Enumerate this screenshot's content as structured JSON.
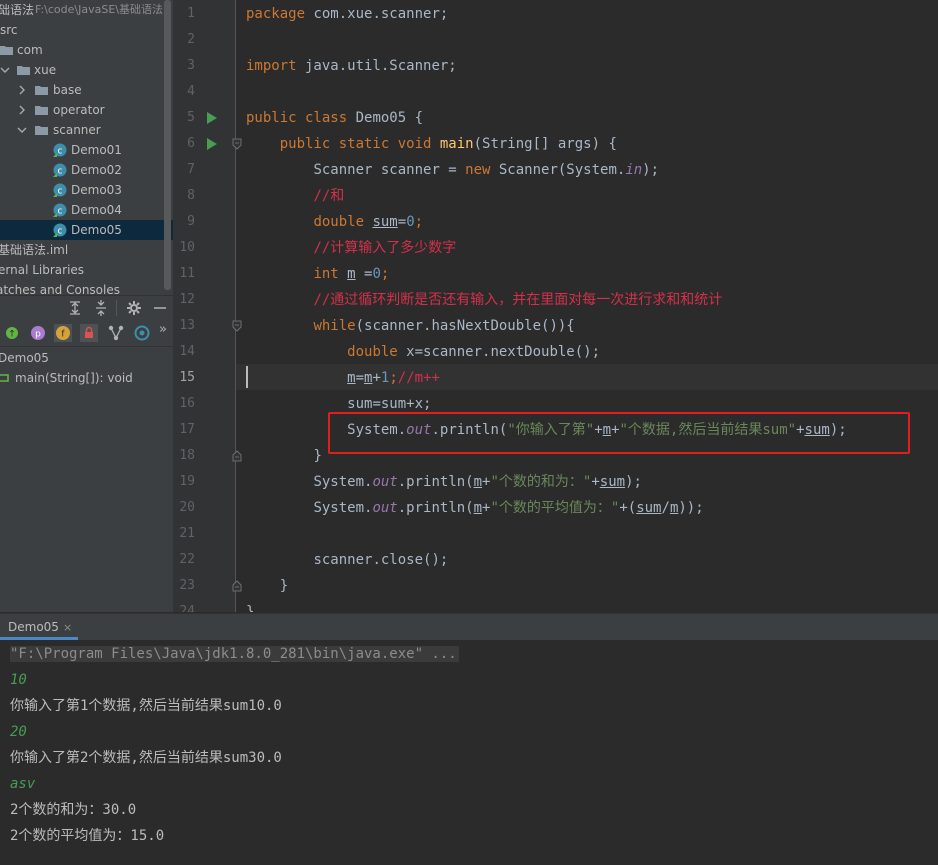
{
  "project_tree": {
    "root_label": "础语法",
    "root_path": "F:\\code\\JavaSE\\基础语法",
    "items": [
      {
        "label": "src"
      },
      {
        "label": "com"
      },
      {
        "label": "xue"
      },
      {
        "label": "base"
      },
      {
        "label": "operator"
      },
      {
        "label": "scanner"
      },
      {
        "label": "Demo01"
      },
      {
        "label": "Demo02"
      },
      {
        "label": "Demo03"
      },
      {
        "label": "Demo04"
      },
      {
        "label": "Demo05"
      },
      {
        "label": "基础语法.iml"
      },
      {
        "label": "ernal Libraries"
      },
      {
        "label": "atches and Consoles"
      }
    ]
  },
  "structure": {
    "class_label": "Demo05",
    "method_label": "main(String[]): void",
    "more_label": "»"
  },
  "editor": {
    "line_numbers": [
      "1",
      "2",
      "3",
      "4",
      "5",
      "6",
      "7",
      "8",
      "9",
      "10",
      "11",
      "12",
      "13",
      "14",
      "15",
      "16",
      "17",
      "18",
      "19",
      "20",
      "21",
      "22",
      "23",
      "24"
    ],
    "active_line": "15",
    "code": {
      "l1_kw": "package",
      "l1_rest": " com.xue.scanner;",
      "l3_kw": "import",
      "l3_rest": " java.util.Scanner;",
      "l5_kw": "public class",
      "l5_rest": " Demo05 {",
      "l6_kw": "public static void",
      "l6_mth": "main",
      "l6_rest": "(String[] args) {",
      "l7_a": "Scanner scanner = ",
      "l7_kw": "new",
      "l7_b": " Scanner(System.",
      "l7_fld": "in",
      "l7_c": ");",
      "l8_cmt": "//和",
      "l9_kw": "double",
      "l9_var": "sum",
      "l9_eq": "=",
      "l9_num": "0",
      "l9_end": ";",
      "l10_cmt": "//计算输入了多少数字",
      "l11_kw": "int",
      "l11_var": "m",
      "l11_eq": " =",
      "l11_num": "0",
      "l11_end": ";",
      "l12_cmt": "//通过循环判断是否还有输入，并在里面对每一次进行求和和统计",
      "l13_kw": "while",
      "l13_rest": "(scanner.hasNextDouble()){",
      "l14_kw": "double",
      "l14_rest": " x=scanner.nextDouble();",
      "l15_var": "m",
      "l15_eq": "=",
      "l15_var2": "m",
      "l15_plus": "+",
      "l15_num": "1",
      "l15_semi": ";",
      "l15_cmt": "//m++",
      "l16": "sum=sum+x;",
      "l17_a": "System.",
      "l17_fld": "out",
      "l17_b": ".println(",
      "l17_str1": "\"你输入了第\"",
      "l17_c": "+",
      "l17_m": "m",
      "l17_d": "+",
      "l17_str2": "\"个数据,然后当前结果sum\"",
      "l17_e": "+",
      "l17_sum": "sum",
      "l17_f": ");",
      "l18": "}",
      "l19_a": "System.",
      "l19_fld": "out",
      "l19_b": ".println(",
      "l19_m": "m",
      "l19_c": "+",
      "l19_str": "\"个数的和为：\"",
      "l19_d": "+",
      "l19_sum": "sum",
      "l19_e": ");",
      "l20_a": "System.",
      "l20_fld": "out",
      "l20_b": ".println(",
      "l20_m": "m",
      "l20_c": "+",
      "l20_str": "\"个数的平均值为：\"",
      "l20_d": "+(",
      "l20_sum": "sum",
      "l20_slash": "/",
      "l20_m2": "m",
      "l20_e": "));",
      "l22": "scanner.close();",
      "l23": "}",
      "l24": "}"
    }
  },
  "run": {
    "tab_label": "Demo05",
    "tab_close": "×",
    "console": {
      "cmd": "\"F:\\Program Files\\Java\\jdk1.8.0_281\\bin\\java.exe\" ...",
      "in1": "10",
      "out1": "你输入了第1个数据,然后当前结果sum10.0",
      "in2": "20",
      "out2": "你输入了第2个数据,然后当前结果sum30.0",
      "in3": "asv",
      "out3": "2个数的和为：30.0",
      "out4": "2个数的平均值为：15.0"
    }
  },
  "colors": {
    "editor_bg": "#2b2b2b",
    "panel_bg": "#3c3f41",
    "keyword": "#cc7832",
    "string": "#6a8759",
    "comment": "#d2304b",
    "number": "#6897bb",
    "field": "#9876aa",
    "method": "#ffc66d",
    "highlight_box": "#e01e1e",
    "user_input": "#499c54"
  }
}
